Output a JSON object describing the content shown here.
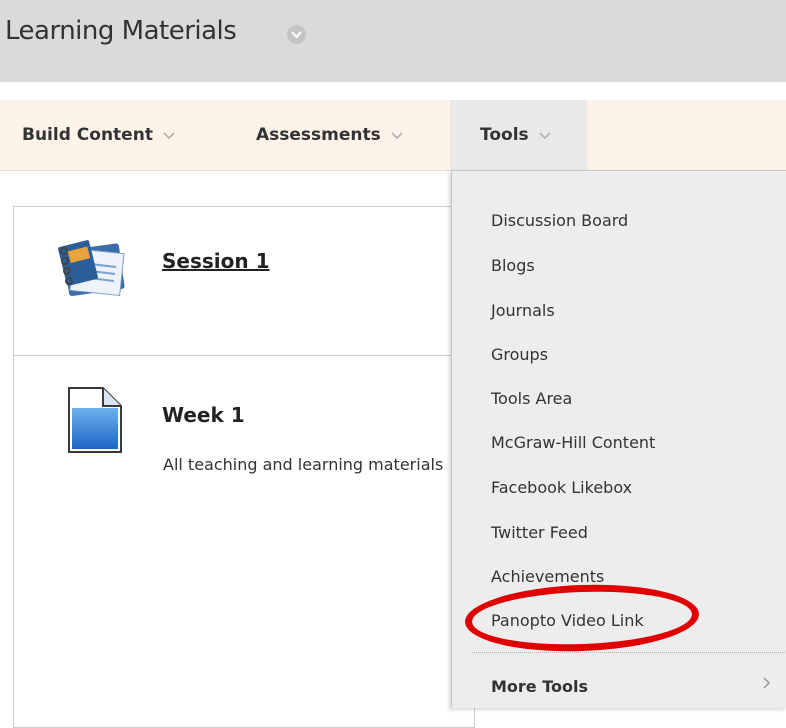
{
  "header": {
    "title": "Learning Materials"
  },
  "toolbar": {
    "build_content": "Build Content",
    "assessments": "Assessments",
    "tools": "Tools"
  },
  "content": {
    "items": [
      {
        "title": "Session 1",
        "icon": "notebook-icon"
      },
      {
        "title": "Week 1",
        "description": "All teaching and learning materials",
        "icon": "document-icon"
      }
    ]
  },
  "tools_menu": {
    "items": [
      "Discussion Board",
      "Blogs",
      "Journals",
      "Groups",
      "Tools Area",
      "McGraw-Hill Content",
      "Facebook Likebox",
      "Twitter Feed",
      "Achievements",
      "Panopto Video Link"
    ],
    "more_tools": "More Tools"
  },
  "colors": {
    "header_bg": "#dadada",
    "toolbar_bg": "#fdf3e8",
    "dropdown_bg": "#ededed",
    "highlight": "#e00000"
  }
}
